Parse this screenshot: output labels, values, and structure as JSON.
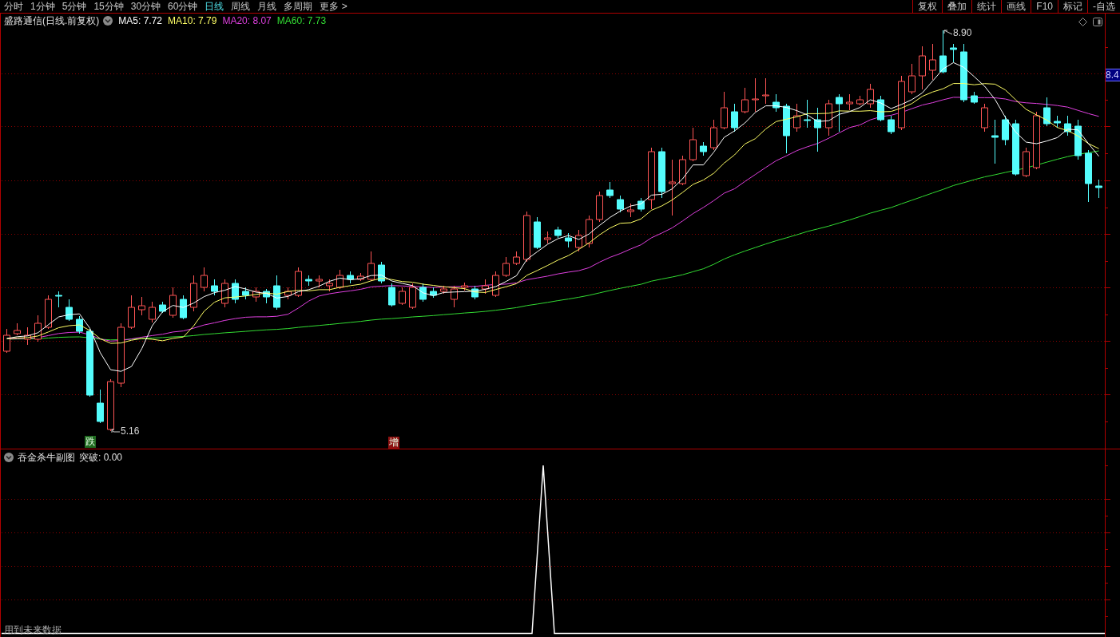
{
  "toolbar": {
    "periods": [
      {
        "label": "分时",
        "selected": false
      },
      {
        "label": "1分钟",
        "selected": false
      },
      {
        "label": "5分钟",
        "selected": false
      },
      {
        "label": "15分钟",
        "selected": false
      },
      {
        "label": "30分钟",
        "selected": false
      },
      {
        "label": "60分钟",
        "selected": false
      },
      {
        "label": "日线",
        "selected": true
      },
      {
        "label": "周线",
        "selected": false
      },
      {
        "label": "月线",
        "selected": false
      },
      {
        "label": "多周期",
        "selected": false
      },
      {
        "label": "更多 >",
        "selected": false
      }
    ],
    "tools": [
      "复权",
      "叠加",
      "统计",
      "画线",
      "F10",
      "标记",
      "-自选"
    ]
  },
  "main_chart": {
    "title": "盛路通信(日线.前复权)",
    "indicators": [
      {
        "label": "MA5: 7.72",
        "color": "#ffffff"
      },
      {
        "label": "MA10: 7.79",
        "color": "#ffff66"
      },
      {
        "label": "MA20: 8.07",
        "color": "#e040e0"
      },
      {
        "label": "MA60: 7.73",
        "color": "#33dd33"
      }
    ],
    "high_label": "8.90",
    "low_label": "5.16",
    "price_tag": "8.4",
    "signals": [
      {
        "label": "跌",
        "color": "#1f6b1f"
      },
      {
        "label": "增",
        "color": "#8c1010"
      }
    ]
  },
  "sub_chart": {
    "title": "吞金杀牛副图",
    "reading": "突破: 0.00"
  },
  "footnote": "用到未来数据"
}
